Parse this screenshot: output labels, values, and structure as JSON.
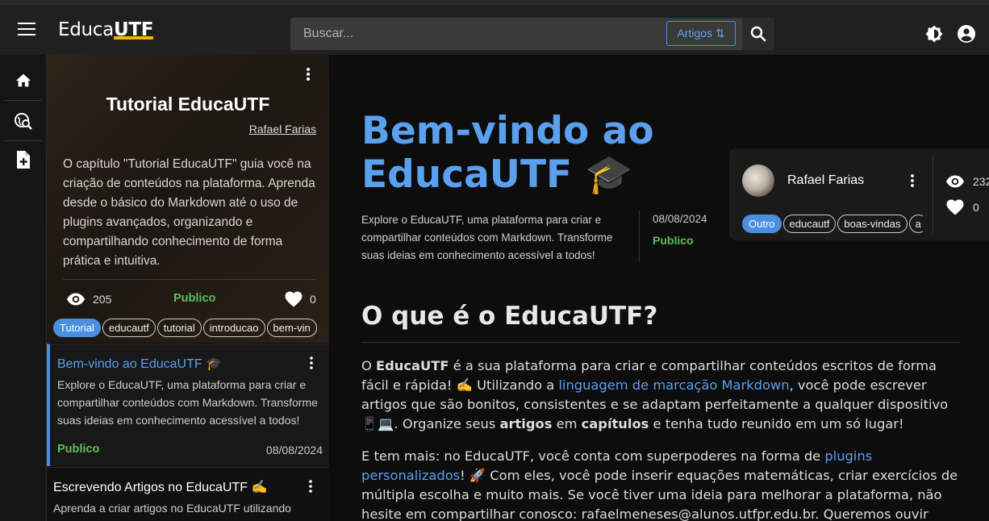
{
  "header": {
    "logo_prefix": "Educa",
    "logo_suffix": "UTF",
    "search_placeholder": "Buscar...",
    "search_filter": "Artigos ⇅"
  },
  "chapter": {
    "title": "Tutorial EducaUTF",
    "author": "Rafael Farias",
    "description": "O capítulo \"Tutorial EducaUTF\" guia você na criação de conteúdos na plataforma. Aprenda desde o básico do Markdown até o uso de plugins avançados, organizando e compartilhando conhecimento de forma prática e intuitiva.",
    "views": "205",
    "status": "Publico",
    "likes": "0",
    "tags": [
      "Tutorial",
      "educautf",
      "tutorial",
      "introducao",
      "bem-vin"
    ]
  },
  "articles": [
    {
      "title": "Bem-vindo ao EducaUTF 🎓",
      "summary": "Explore o EducaUTF, uma plataforma para criar e compartilhar conteúdos com Markdown. Transforme suas ideias em conhecimento acessível a todos!",
      "status": "Publico",
      "date": "08/08/2024"
    },
    {
      "title": "Escrevendo Artigos no EducaUTF ✍️",
      "summary": "Aprenda a criar artigos no EducaUTF utilizando"
    }
  ],
  "article": {
    "title": "Bem-vindo ao EducaUTF 🎓",
    "intro": "Explore o EducaUTF, uma plataforma para criar e compartilhar conteúdos com Markdown. Transforme suas ideias em conhecimento acessível a todos!",
    "date": "08/08/2024",
    "status": "Publico",
    "author": "Rafael Farias",
    "views": "232",
    "likes": "0",
    "tags": [
      "Outro",
      "educautf",
      "boas-vindas",
      "a"
    ],
    "section_title": "O que é o EducaUTF?",
    "p1": {
      "t1": "O ",
      "b1": "EducaUTF",
      "t2": " é a sua plataforma para criar e compartilhar conteúdos escritos de forma fácil e rápida! ✍️ Utilizando a ",
      "link1": "linguagem de marcação Markdown",
      "t3": ", você pode escrever artigos que são bonitos, consistentes e se adaptam perfeitamente a qualquer dispositivo 📱💻. Organize seus ",
      "b2": "artigos",
      "t4": " em ",
      "b3": "capítulos",
      "t5": " e tenha tudo reunido em um só lugar!"
    },
    "p2": {
      "t1": "E tem mais: no EducaUTF, você conta com superpoderes na forma de ",
      "link1": "plugins personalizados",
      "t2": "! 🚀 Com eles, você pode inserir equações matemáticas, criar exercícios de múltipla escolha e muito mais. Se você tiver uma ideia para melhorar a plataforma, não hesite em compartilhar conosco: rafaelmeneses@alunos.utfpr.edu.br. Queremos ouvir você! 😊"
    }
  },
  "colors": {
    "accent": "#4a8fe0",
    "link": "#5aa0ef",
    "published": "#5bbf5b",
    "logo_accent": "#f5b700"
  }
}
